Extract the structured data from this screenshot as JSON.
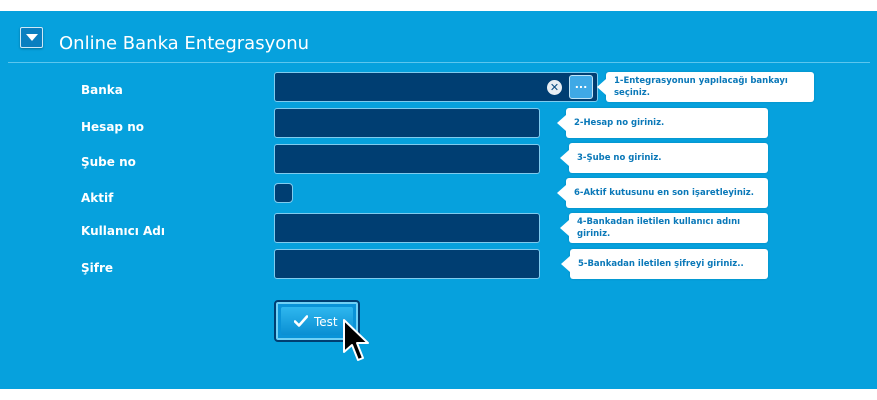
{
  "header": {
    "title": "Online Banka Entegrasyonu",
    "collapse_icon": "chevron-down-icon"
  },
  "form": {
    "fields": [
      {
        "label": "Banka",
        "value": "",
        "tip": "1-Entegrasyonun yapılacağı bankayı seçiniz."
      },
      {
        "label": "Hesap no",
        "value": "",
        "tip": "2-Hesap no giriniz."
      },
      {
        "label": "Şube no",
        "value": "",
        "tip": "3-Şube no giriniz."
      },
      {
        "label": "Aktif",
        "checked": false,
        "tip": "6-Aktif kutusunu en son işaretleyiniz."
      },
      {
        "label": "Kullanıcı Adı",
        "value": "",
        "tip": "4-Bankadan iletilen kullanıcı adını giriniz."
      },
      {
        "label": "Şifre",
        "value": "",
        "tip": "5-Bankadan iletilen şifreyi giriniz.."
      }
    ],
    "bank_clear_icon": "close-icon",
    "bank_lookup_label": "...",
    "test_button_label": "Test",
    "test_button_icon": "checkmark-icon"
  },
  "colors": {
    "panel_bg": "#06a1dd",
    "field_bg": "#003e72",
    "tip_text": "#0a78b8"
  }
}
